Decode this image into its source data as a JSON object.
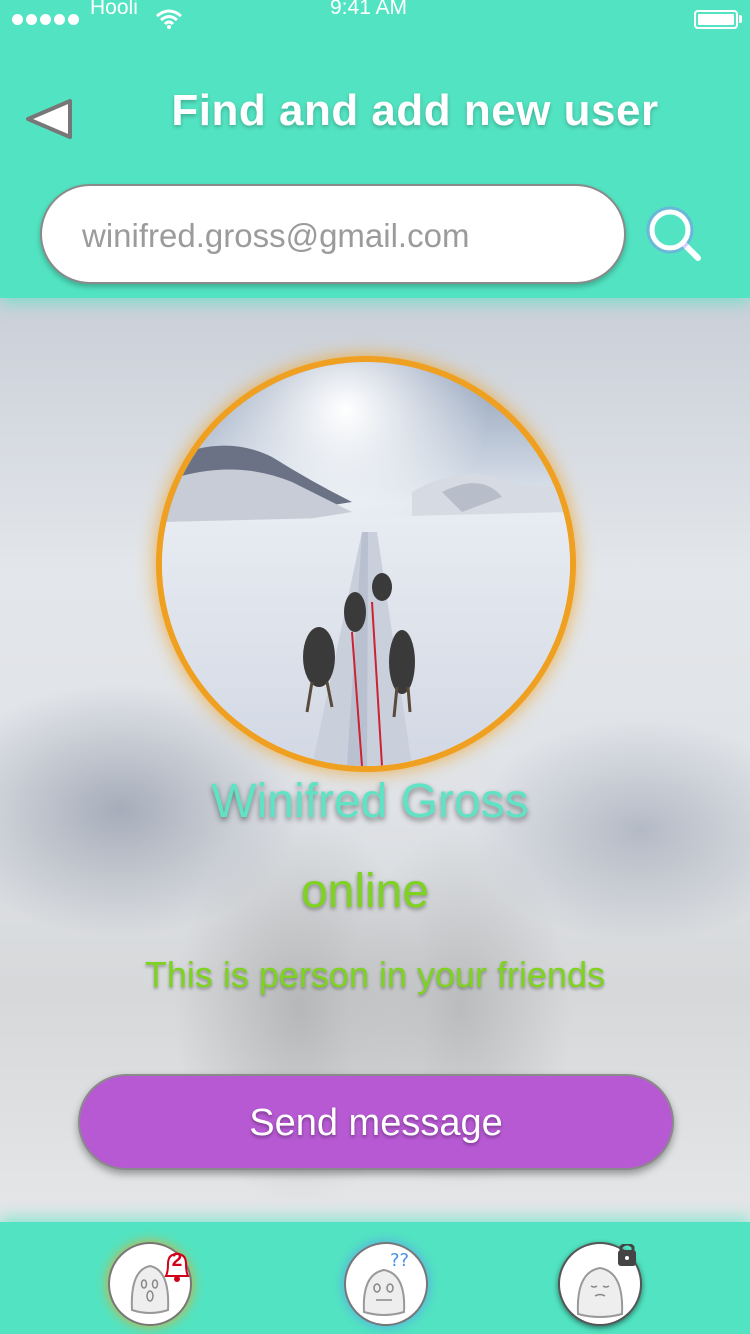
{
  "status_bar": {
    "carrier": "Hooli",
    "time": "9:41 AM"
  },
  "header": {
    "title": "Find and add new user"
  },
  "search": {
    "value": "winifred.gross@gmail.com"
  },
  "profile": {
    "name": "Winifred Gross",
    "status": "online",
    "friend_note": "This is person in your friends"
  },
  "actions": {
    "send_message_label": "Send message"
  },
  "tabbar": {
    "notifications_count": "2",
    "icons": [
      "ghost-notifications-icon",
      "ghost-question-icon",
      "ghost-locked-icon"
    ]
  },
  "colors": {
    "accent": "#52e4c2",
    "button": "#b759d3",
    "online": "#7ed321",
    "ring": "#f0a020"
  }
}
